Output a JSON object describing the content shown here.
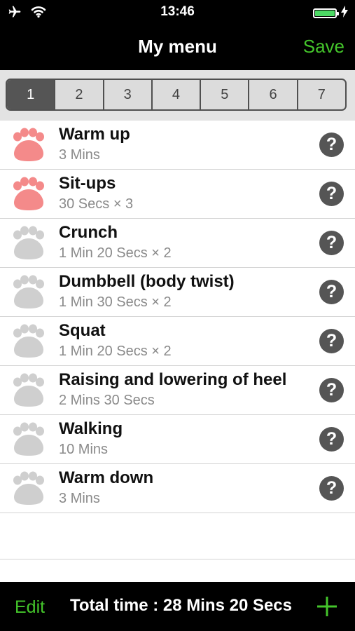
{
  "status_bar": {
    "time": "13:46",
    "icons": [
      "airplane-icon",
      "wifi-icon",
      "battery-icon",
      "charging-icon"
    ],
    "battery_color": "#4cd964"
  },
  "nav": {
    "title": "My menu",
    "save_label": "Save"
  },
  "segments": {
    "labels": [
      "1",
      "2",
      "3",
      "4",
      "5",
      "6",
      "7"
    ],
    "selected": "1"
  },
  "exercises": [
    {
      "name": "Warm up",
      "detail": "3 Mins",
      "paw_color": "#f48a8a"
    },
    {
      "name": "Sit-ups",
      "detail": "30 Secs × 3",
      "paw_color": "#f48a8a"
    },
    {
      "name": "Crunch",
      "detail": "1 Min 20 Secs × 2",
      "paw_color": "#cfcfcf"
    },
    {
      "name": "Dumbbell (body twist)",
      "detail": "1 Min 30 Secs × 2",
      "paw_color": "#cfcfcf"
    },
    {
      "name": "Squat",
      "detail": "1 Min 20 Secs × 2",
      "paw_color": "#cfcfcf"
    },
    {
      "name": "Raising and lowering of heel",
      "detail": "2 Mins 30 Secs",
      "paw_color": "#cfcfcf"
    },
    {
      "name": "Walking",
      "detail": "10 Mins",
      "paw_color": "#cfcfcf"
    },
    {
      "name": "Warm down",
      "detail": "3 Mins",
      "paw_color": "#cfcfcf"
    }
  ],
  "help_symbol": "?",
  "toolbar": {
    "edit_label": "Edit",
    "total_time": "Total time : 28 Mins 20 Secs"
  },
  "colors": {
    "accent": "#44c52b",
    "paw_active": "#f48a8a",
    "paw_inactive": "#cfcfcf"
  }
}
